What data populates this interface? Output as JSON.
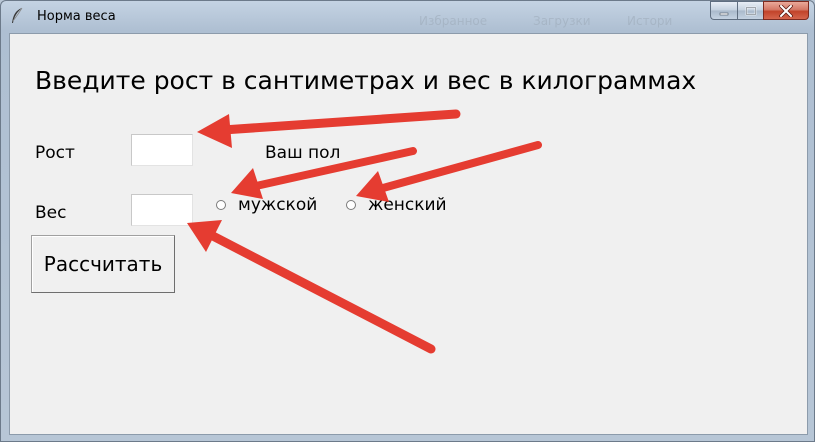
{
  "window": {
    "title": "Норма веса",
    "background_tabs": [
      "Избранное",
      "Загрузки",
      "Истори"
    ]
  },
  "form": {
    "heading": "Введите рост в сантиметрах и вес в килограммах",
    "height_label": "Рост",
    "weight_label": "Вес",
    "height_value": "",
    "weight_value": "",
    "sex_label": "Ваш пол",
    "sex_options": [
      {
        "label": "мужской",
        "selected": false
      },
      {
        "label": "женский",
        "selected": false
      }
    ],
    "calculate_button": "Рассчитать"
  },
  "annotations": {
    "arrow_color": "#e53c31"
  }
}
